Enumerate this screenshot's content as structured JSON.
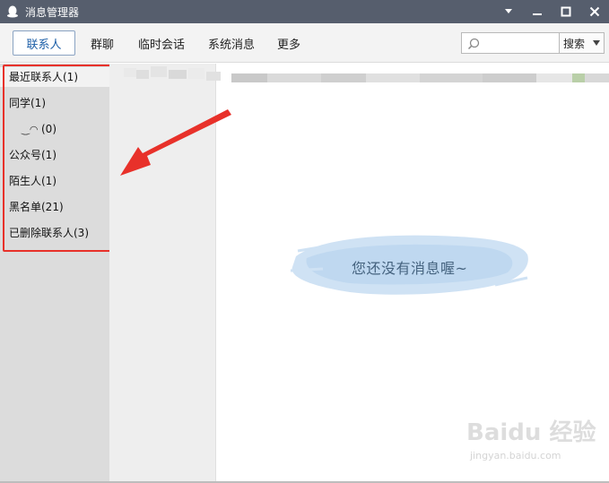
{
  "window": {
    "title": "消息管理器"
  },
  "tabs": [
    {
      "label": "联系人",
      "active": true
    },
    {
      "label": "群聊",
      "active": false
    },
    {
      "label": "临时会话",
      "active": false
    },
    {
      "label": "系统消息",
      "active": false
    },
    {
      "label": "更多",
      "active": false
    }
  ],
  "search": {
    "value": "",
    "placeholder": "",
    "button_label": "搜索"
  },
  "sidebar": {
    "items": [
      {
        "label": "最近联系人(1)"
      },
      {
        "label": "同学(1)"
      },
      {
        "label": "(0)"
      },
      {
        "label": "公众号(1)"
      },
      {
        "label": "陌生人(1)"
      },
      {
        "label": "黑名单(21)"
      },
      {
        "label": "已删除联系人(3)"
      }
    ]
  },
  "content": {
    "empty_message": "您还没有消息喔~"
  },
  "watermark": {
    "logo": "Baidu 经验",
    "url": "jingyan.baidu.com"
  },
  "colors": {
    "titlebar": "#565e6d",
    "highlight_box": "#e8312a",
    "arrow": "#e8312a",
    "active_tab_text": "#1d5fa8"
  }
}
